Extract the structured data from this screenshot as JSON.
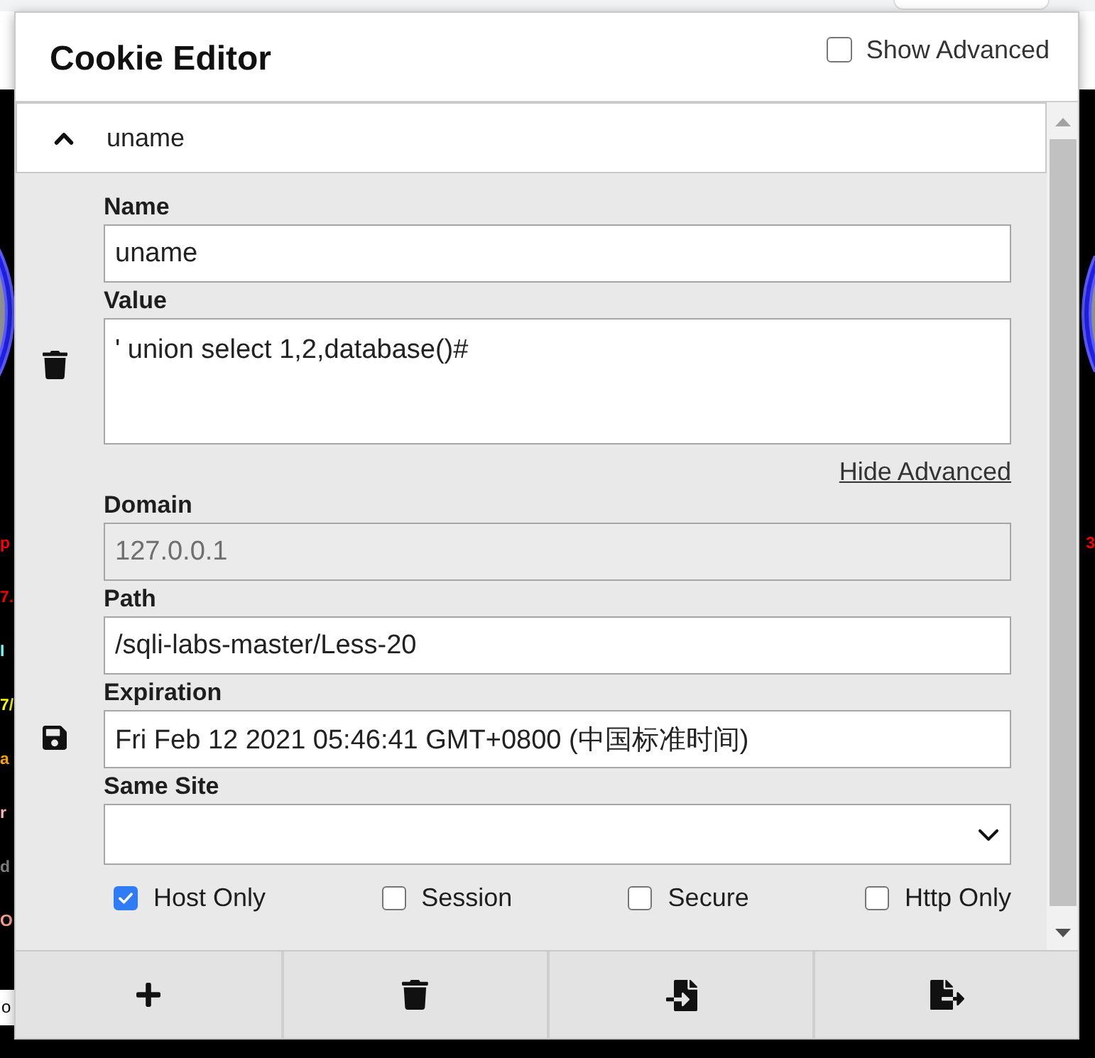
{
  "background_page": {
    "left_fragments": [
      {
        "text": "p",
        "color": "#ff0000"
      },
      {
        "text": "7.",
        "color": "#ff0000"
      },
      {
        "text": "I",
        "color": "#66ffff"
      },
      {
        "text": "7/",
        "color": "#ffff00"
      },
      {
        "text": "a",
        "color": "#ffa500"
      },
      {
        "text": "r",
        "color": "#ffb6b6"
      },
      {
        "text": "d",
        "color": "#808080"
      },
      {
        "text": "O",
        "color": "#ff9f8f"
      }
    ],
    "right_fragments": [
      {
        "text": "3",
        "color": "#ff0000"
      }
    ],
    "footer_fragment": "o"
  },
  "popup": {
    "title": "Cookie Editor",
    "show_advanced": {
      "label": "Show Advanced",
      "checked": false
    }
  },
  "cookies": [
    {
      "name": "uname",
      "expanded": true,
      "fields": [
        {
          "kind": "text",
          "label": "Name",
          "value": "uname",
          "disabled": false
        },
        {
          "kind": "textarea",
          "label": "Value",
          "value": "' union select 1,2,database()#",
          "disabled": false
        }
      ],
      "advanced_toggle": "Hide Advanced",
      "advanced_fields": [
        {
          "kind": "text",
          "label": "Domain",
          "value": "127.0.0.1",
          "disabled": true
        },
        {
          "kind": "text",
          "label": "Path",
          "value": "/sqli-labs-master/Less-20",
          "disabled": false
        },
        {
          "kind": "text",
          "label": "Expiration",
          "value": "Fri Feb 12 2021 05:46:41 GMT+0800 (中国标准时间)",
          "disabled": false
        },
        {
          "kind": "select",
          "label": "Same Site",
          "disabled": false
        }
      ],
      "flags": [
        {
          "label": "Host Only",
          "checked": true
        },
        {
          "label": "Session",
          "checked": false
        },
        {
          "label": "Secure",
          "checked": false
        },
        {
          "label": "Http Only",
          "checked": false
        }
      ],
      "actions": [
        {
          "kind": "delete"
        },
        {
          "kind": "save"
        }
      ]
    }
  ],
  "toolbar": [
    {
      "kind": "add"
    },
    {
      "kind": "delete"
    },
    {
      "kind": "import"
    },
    {
      "kind": "export"
    }
  ]
}
